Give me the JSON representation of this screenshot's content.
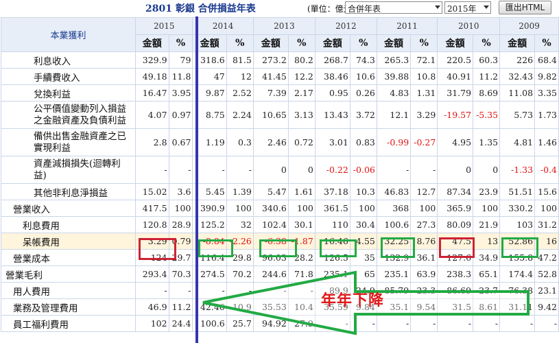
{
  "toolbar": {
    "title": "2801 彰銀 合併損益年表",
    "unit": "(單位：億元)",
    "report_select": "合併年表",
    "year_select": "2015年",
    "export_button": "匯出HTML"
  },
  "table": {
    "item_header": "本業獲利",
    "years": [
      "2015",
      "2014",
      "2013",
      "2012",
      "2011",
      "2010",
      "2009"
    ],
    "amount_label": "金額",
    "pct_label": "%",
    "rows": [
      {
        "label": "利息收入",
        "indent": "l1",
        "values": [
          "329.9",
          "79",
          "318.6",
          "81.5",
          "273.2",
          "80.2",
          "268.7",
          "74.3",
          "265.3",
          "72.1",
          "220.5",
          "60.3",
          "226",
          "68.4"
        ]
      },
      {
        "label": "手續費收入",
        "indent": "l1",
        "values": [
          "49.18",
          "11.8",
          "47",
          "12",
          "41.45",
          "12.2",
          "38.46",
          "10.6",
          "39.88",
          "10.8",
          "40.91",
          "11.2",
          "32.43",
          "9.82"
        ]
      },
      {
        "label": "兌換利益",
        "indent": "l1",
        "values": [
          "16.47",
          "3.95",
          "9.87",
          "2.52",
          "7.39",
          "2.17",
          "0.95",
          "0.26",
          "4.83",
          "1.31",
          "31.79",
          "8.69",
          "11.08",
          "3.35"
        ]
      },
      {
        "label": "公平價值變動列入損益之金融資產及負債利益",
        "indent": "l1",
        "tall": true,
        "values": [
          "4.07",
          "0.97",
          "8.75",
          "2.24",
          "10.65",
          "3.13",
          "13.43",
          "3.72",
          "12.1",
          "3.29",
          "-19.57",
          "-5.35",
          "5.73",
          "1.73"
        ]
      },
      {
        "label": "備供出售金融資產之已實現利益",
        "indent": "l1",
        "tall": true,
        "values": [
          "2.8",
          "0.67",
          "1.19",
          "0.3",
          "2.46",
          "0.72",
          "3.01",
          "0.83",
          "-0.99",
          "-0.27",
          "4.95",
          "1.35",
          "4.81",
          "1.46"
        ]
      },
      {
        "label": "資產減損損失(迴轉利益)",
        "indent": "l1",
        "tall": true,
        "values": [
          "-",
          "-",
          "-",
          "-",
          "0",
          "0",
          "-0.22",
          "-0.06",
          "-",
          "-",
          "0",
          "0",
          "-1.33",
          "-0.4"
        ]
      },
      {
        "label": "其他非利息淨損益",
        "indent": "l1",
        "values": [
          "15.02",
          "3.6",
          "5.45",
          "1.39",
          "5.47",
          "1.61",
          "37.18",
          "10.3",
          "46.83",
          "12.7",
          "87.34",
          "23.9",
          "51.51",
          "15.6"
        ]
      },
      {
        "label": "營業收入",
        "indent": "l3",
        "values": [
          "417.5",
          "100",
          "390.9",
          "100",
          "340.6",
          "100",
          "361.5",
          "100",
          "368",
          "100",
          "365.9",
          "100",
          "330.2",
          "100"
        ]
      },
      {
        "label": "利息費用",
        "indent": "l2",
        "values": [
          "120.8",
          "28.9",
          "125.2",
          "32",
          "102.4",
          "30.1",
          "110",
          "30.4",
          "100.6",
          "27.3",
          "80.09",
          "21.9",
          "103",
          "31.2"
        ]
      },
      {
        "label": "呆帳費用",
        "indent": "l2",
        "highlight": true,
        "values": [
          "3.29",
          "0.79",
          "-8.84",
          "-2.26",
          "-6.38",
          "-1.87",
          "16.46",
          "4.55",
          "32.25",
          "8.76",
          "47.5",
          "13",
          "52.86",
          "16"
        ]
      },
      {
        "label": "營業成本",
        "indent": "l3",
        "values": [
          "124",
          "29.7",
          "116.4",
          "29.8",
          "96.03",
          "28.2",
          "126.5",
          "35",
          "132.9",
          "36.1",
          "127.6",
          "34.9",
          "155.8",
          "47.2"
        ]
      },
      {
        "label": "營業毛利",
        "indent": "l4",
        "values": [
          "293.4",
          "70.3",
          "274.5",
          "70.2",
          "244.6",
          "71.8",
          "235.1",
          "65",
          "235.1",
          "63.9",
          "238.3",
          "65.1",
          "174.4",
          "52.8"
        ]
      },
      {
        "label": "用人費用",
        "indent": "l3",
        "values": [
          "-",
          "-",
          "-",
          "-",
          "-",
          "-",
          "89.9",
          "24.9",
          "85.79",
          "23.3",
          "86.69",
          "23.7",
          "76.38",
          "23.1"
        ]
      },
      {
        "label": "業務及管理費用",
        "indent": "l3",
        "values": [
          "46.9",
          "11.2",
          "42.46",
          "10.9",
          "35.53",
          "10.4",
          "35.59",
          "9.84",
          "35.1",
          "9.54",
          "31.5",
          "8.61",
          "31.11",
          "9.42"
        ]
      },
      {
        "label": "員工福利費用",
        "indent": "l3",
        "values": [
          "102",
          "24.4",
          "100.6",
          "25.7",
          "94.92",
          "27.9",
          "-",
          "-",
          "-",
          "-",
          "-",
          "-",
          "-",
          "-"
        ]
      }
    ]
  },
  "annotation": {
    "text": "年年下降",
    "line_color": "#3535b0",
    "red_color": "#cc2233",
    "green_color": "#22aa44"
  }
}
